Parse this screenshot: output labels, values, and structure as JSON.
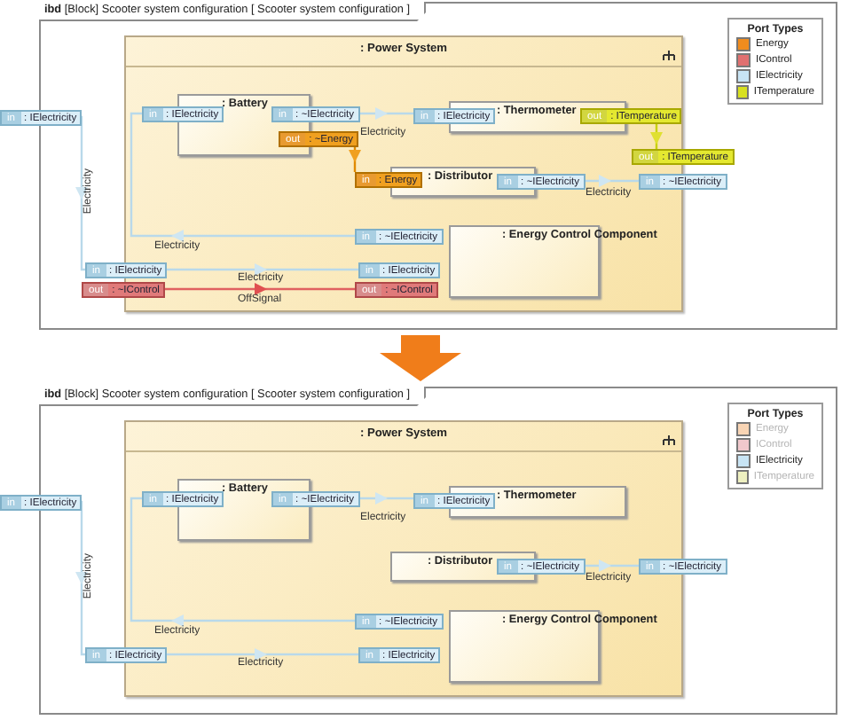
{
  "diagrams": [
    {
      "frame_title": "**ibd** [Block] Scooter system configuration [ Scooter system configuration ]",
      "system": {
        "title": ": Power System"
      },
      "frame_ports": [
        {
          "direction": "in",
          "name": ": IElectricity",
          "kind": "electricity"
        },
        {
          "direction": "in",
          "name": ": IElectricity",
          "kind": "electricity"
        },
        {
          "direction": "in",
          "name": ": ~IElectricity",
          "kind": "electricity"
        },
        {
          "direction": "out",
          "name": ": ~IControl",
          "kind": "control"
        },
        {
          "direction": "out",
          "name": ": ITemperature",
          "kind": "temperature"
        }
      ],
      "parts": [
        {
          "title": ": Battery",
          "ports": [
            {
              "direction": "in",
              "name": ": IElectricity",
              "kind": "electricity"
            },
            {
              "direction": "in",
              "name": ": ~IElectricity",
              "kind": "electricity"
            },
            {
              "direction": "out",
              "name": ": ~Energy",
              "kind": "energy"
            }
          ]
        },
        {
          "title": ": Thermometer",
          "ports": [
            {
              "direction": "in",
              "name": ": IElectricity",
              "kind": "electricity"
            },
            {
              "direction": "out",
              "name": ": ITemperature",
              "kind": "temperature"
            }
          ]
        },
        {
          "title": ": Distributor",
          "ports": [
            {
              "direction": "in",
              "name": ": Energy",
              "kind": "energy"
            },
            {
              "direction": "in",
              "name": ": ~IElectricity",
              "kind": "electricity"
            }
          ]
        },
        {
          "title": ": Energy Control Component",
          "ports": [
            {
              "direction": "in",
              "name": ": ~IElectricity",
              "kind": "electricity"
            },
            {
              "direction": "in",
              "name": ": IElectricity",
              "kind": "electricity"
            },
            {
              "direction": "out",
              "name": ": ~IControl",
              "kind": "control"
            }
          ]
        }
      ],
      "connectors": [
        {
          "kind": "electricity",
          "label": "Electricity"
        },
        {
          "kind": "electricity",
          "label": "Electricity"
        },
        {
          "kind": "electricity",
          "label": "Electricity"
        },
        {
          "kind": "electricity",
          "label": "Electricity"
        },
        {
          "kind": "electricity",
          "label": "Electricity"
        },
        {
          "kind": "energy"
        },
        {
          "kind": "temperature"
        },
        {
          "kind": "control",
          "label": "OffSignal"
        }
      ],
      "legend": {
        "title": "Port Types",
        "items": [
          {
            "label": "Energy",
            "color": "#f08c1e",
            "dimmed": false
          },
          {
            "label": "IControl",
            "color": "#e07070",
            "dimmed": false
          },
          {
            "label": "IElectricity",
            "color": "#c8e4f4",
            "dimmed": false
          },
          {
            "label": "ITemperature",
            "color": "#d8e020",
            "dimmed": false
          }
        ]
      }
    },
    {
      "frame_title": "**ibd** [Block] Scooter system configuration [ Scooter system configuration ]",
      "system": {
        "title": ": Power System"
      },
      "frame_ports": [
        {
          "direction": "in",
          "name": ": IElectricity",
          "kind": "electricity"
        },
        {
          "direction": "in",
          "name": ": IElectricity",
          "kind": "electricity"
        },
        {
          "direction": "in",
          "name": ": ~IElectricity",
          "kind": "electricity"
        }
      ],
      "parts": [
        {
          "title": ": Battery",
          "ports": [
            {
              "direction": "in",
              "name": ": IElectricity",
              "kind": "electricity"
            },
            {
              "direction": "in",
              "name": ": ~IElectricity",
              "kind": "electricity"
            }
          ]
        },
        {
          "title": ": Thermometer",
          "ports": [
            {
              "direction": "in",
              "name": ": IElectricity",
              "kind": "electricity"
            }
          ]
        },
        {
          "title": ": Distributor",
          "ports": [
            {
              "direction": "in",
              "name": ": ~IElectricity",
              "kind": "electricity"
            }
          ]
        },
        {
          "title": ": Energy Control Component",
          "ports": [
            {
              "direction": "in",
              "name": ": ~IElectricity",
              "kind": "electricity"
            },
            {
              "direction": "in",
              "name": ": IElectricity",
              "kind": "electricity"
            }
          ]
        }
      ],
      "connectors": [
        {
          "kind": "electricity",
          "label": "Electricity"
        },
        {
          "kind": "electricity",
          "label": "Electricity"
        },
        {
          "kind": "electricity",
          "label": "Electricity"
        },
        {
          "kind": "electricity",
          "label": "Electricity"
        },
        {
          "kind": "electricity",
          "label": "Electricity"
        }
      ],
      "legend": {
        "title": "Port Types",
        "items": [
          {
            "label": "Energy",
            "color": "#f8d4b4",
            "dimmed": true
          },
          {
            "label": "IControl",
            "color": "#f0c8cc",
            "dimmed": true
          },
          {
            "label": "IElectricity",
            "color": "#c8e4f4",
            "dimmed": false
          },
          {
            "label": "ITemperature",
            "color": "#eef0c0",
            "dimmed": true
          }
        ]
      }
    }
  ]
}
